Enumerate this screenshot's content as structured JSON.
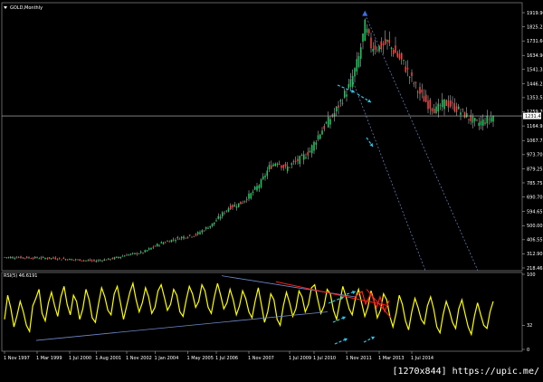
{
  "window": {
    "title": "GOLD,Monthly"
  },
  "watermark": "[1270x844] https://upic.me/",
  "colors": {
    "background": "#000000",
    "bull_candle": "#22c55e",
    "bear_candle": "#ef4444",
    "wick": "#d4d4d4",
    "rsi_line": "#ffff00",
    "channel_line": "#6f89c8",
    "price_line": "#c8c8c8",
    "arrow": "#29c8f0",
    "divergence": "#ff2020",
    "up_arrow_marker": "#3b6fe8"
  },
  "icons": {
    "menu_arrow": "triangle-down-icon",
    "peak_marker": "up-arrow-icon"
  },
  "current_price_label": "1231.46",
  "chart_data": [
    {
      "type": "candlestick",
      "title": "GOLD,Monthly",
      "xlabel": "",
      "ylabel": "",
      "ylim": [
        218.46,
        1919.9
      ],
      "y_ticks": [
        "1919.90",
        "1825.25",
        "1731.60",
        "1634.90",
        "1541.35",
        "1446.25",
        "1353.55",
        "1259.70",
        "1164.95",
        "1067.75",
        "973.70",
        "879.25",
        "785.75",
        "690.70",
        "594.65",
        "500.00",
        "406.55",
        "312.90",
        "218.46"
      ],
      "x_tick_labels": [
        "1 Nov 1997",
        "1 Mar 1999",
        "1 Jul 2000",
        "1 Aug 2001",
        "1 Nov 2002",
        "1 Jan 2004",
        "1 May 2005",
        "1 Jul 2006",
        "1 Nov 2007",
        "1 Jul 2009",
        "1 Jul 2010",
        "1 Nov 2011",
        "1 Mar 2013",
        "1 Jul 2014"
      ],
      "x_tick_months": [
        0,
        16,
        32,
        45,
        60,
        74,
        90,
        104,
        120,
        140,
        152,
        168,
        184,
        200
      ],
      "overlays": [
        "descending channel from 2011 high",
        "horizontal line at current price"
      ],
      "series": {
        "close_points": [
          [
            0,
            290
          ],
          [
            12,
            287
          ],
          [
            24,
            283
          ],
          [
            36,
            272
          ],
          [
            44,
            265
          ],
          [
            52,
            278
          ],
          [
            60,
            305
          ],
          [
            68,
            322
          ],
          [
            76,
            380
          ],
          [
            86,
            420
          ],
          [
            94,
            440
          ],
          [
            102,
            510
          ],
          [
            110,
            620
          ],
          [
            116,
            650
          ],
          [
            121,
            710
          ],
          [
            126,
            790
          ],
          [
            130,
            890
          ],
          [
            134,
            930
          ],
          [
            138,
            880
          ],
          [
            142,
            920
          ],
          [
            146,
            950
          ],
          [
            150,
            1000
          ],
          [
            154,
            1100
          ],
          [
            158,
            1180
          ],
          [
            162,
            1250
          ],
          [
            166,
            1350
          ],
          [
            170,
            1450
          ],
          [
            174,
            1620
          ],
          [
            177,
            1830
          ],
          [
            180,
            1700
          ],
          [
            184,
            1690
          ],
          [
            188,
            1720
          ],
          [
            192,
            1650
          ],
          [
            196,
            1580
          ],
          [
            200,
            1470
          ],
          [
            204,
            1380
          ],
          [
            208,
            1310
          ],
          [
            212,
            1270
          ],
          [
            216,
            1320
          ],
          [
            220,
            1300
          ],
          [
            224,
            1260
          ],
          [
            228,
            1220
          ],
          [
            232,
            1180
          ],
          [
            236,
            1200
          ],
          [
            240,
            1231
          ]
        ]
      }
    },
    {
      "type": "line",
      "title": "RSI(5) 46.6191",
      "ylim": [
        0,
        100
      ],
      "y_ticks": [
        "100",
        "32",
        "0"
      ],
      "series": {
        "name": "RSI(5)",
        "values": [
          40,
          72,
          55,
          30,
          45,
          64,
          50,
          32,
          24,
          58,
          68,
          80,
          48,
          38,
          62,
          76,
          58,
          44,
          70,
          84,
          60,
          46,
          72,
          64,
          40,
          54,
          80,
          66,
          42,
          36,
          60,
          82,
          70,
          52,
          46,
          74,
          84,
          62,
          40,
          58,
          76,
          88,
          66,
          50,
          62,
          82,
          70,
          48,
          56,
          78,
          86,
          70,
          52,
          60,
          80,
          72,
          50,
          44,
          66,
          84,
          74,
          56,
          64,
          86,
          78,
          56,
          48,
          70,
          88,
          72,
          54,
          62,
          80,
          66,
          46,
          58,
          78,
          68,
          50,
          42,
          64,
          82,
          60,
          36,
          50,
          74,
          66,
          40,
          32,
          58,
          76,
          62,
          44,
          54,
          78,
          70,
          50,
          60,
          82,
          86,
          66,
          48,
          58,
          80,
          74,
          52,
          40,
          62,
          84,
          70,
          54,
          46,
          68,
          80,
          62,
          44,
          56,
          78,
          64,
          42,
          52,
          74,
          66,
          44,
          30,
          48,
          72,
          60,
          38,
          26,
          50,
          68,
          56,
          40,
          34,
          58,
          70,
          54,
          30,
          22,
          46,
          64,
          52,
          36,
          28,
          54,
          66,
          48,
          30,
          20,
          44,
          62,
          46,
          32,
          28,
          50,
          64
        ]
      }
    }
  ]
}
